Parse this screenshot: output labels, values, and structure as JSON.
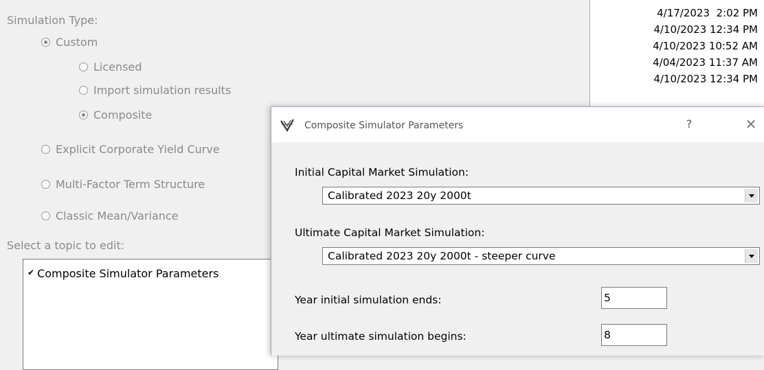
{
  "options": {
    "header": "Simulation Type:",
    "custom": "Custom",
    "licensed": "Licensed",
    "import": "Import simulation results",
    "composite": "Composite",
    "explicit": "Explicit Corporate Yield Curve",
    "multifactor": "Multi-Factor Term Structure",
    "classic": "Classic Mean/Variance",
    "selected_main": "Custom",
    "selected_sub": "Composite"
  },
  "topics": {
    "header": "Select a topic to edit:",
    "item": "Composite Simulator Parameters",
    "check": "✔"
  },
  "dates": [
    "4/17/2023  2:02 PM",
    "4/10/2023 12:34 PM",
    "4/10/2023 10:52 AM",
    "4/04/2023 11:37 AM",
    "4/10/2023 12:34 PM"
  ],
  "dialog": {
    "title": "Composite Simulator Parameters",
    "help": "?",
    "close": "✕",
    "initial_label": "Initial Capital Market Simulation:",
    "initial_value": "Calibrated 2023 20y 2000t",
    "ultimate_label": "Ultimate Capital Market Simulation:",
    "ultimate_value": "Calibrated 2023 20y 2000t - steeper curve",
    "year_initial_label": "Year initial simulation ends:",
    "year_initial_value": "5",
    "year_ultimate_label": "Year ultimate simulation begins:",
    "year_ultimate_value": "8"
  }
}
